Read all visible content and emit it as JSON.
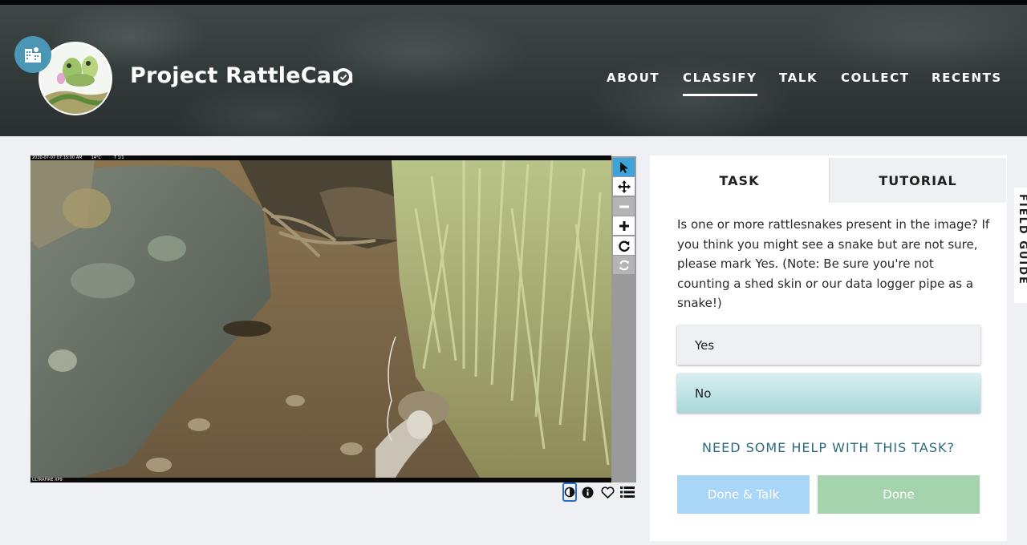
{
  "header": {
    "project_title": "Project RattleCam",
    "nav": [
      {
        "label": "ABOUT",
        "active": false
      },
      {
        "label": "CLASSIFY",
        "active": true
      },
      {
        "label": "TALK",
        "active": false
      },
      {
        "label": "COLLECT",
        "active": false
      },
      {
        "label": "RECENTS",
        "active": false
      }
    ],
    "icons": {
      "org": "organization-building-icon",
      "verified": "verified-check-icon"
    }
  },
  "subject": {
    "camera_stamp": "2020-07-07 07:15:00 AM",
    "temperature": "14°C",
    "trigger": "T 1/1",
    "camera_model": "ULTRAFIRE XP9"
  },
  "toolbar": {
    "tools": [
      {
        "name": "pointer-icon",
        "state": "selected"
      },
      {
        "name": "move-icon",
        "state": "normal"
      },
      {
        "name": "zoom-out-icon",
        "state": "disabled"
      },
      {
        "name": "zoom-in-icon",
        "state": "normal"
      },
      {
        "name": "rotate-icon",
        "state": "normal"
      },
      {
        "name": "reset-icon",
        "state": "disabled"
      }
    ]
  },
  "meta_icons": [
    "invert-icon",
    "info-icon",
    "favorite-heart-icon",
    "collections-list-icon"
  ],
  "task_panel": {
    "tabs": {
      "task": "TASK",
      "tutorial": "TUTORIAL"
    },
    "question": "Is one or more rattlesnakes present in the image? If you think you might see a snake but are not sure, please mark Yes. (Note: Be sure you're not counting a shed skin or our data logger pipe as a snake!)",
    "answers": {
      "yes": "Yes",
      "no": "No"
    },
    "selected_answer": "No",
    "help_link": "NEED SOME HELP WITH THIS TASK?",
    "done_talk": "Done & Talk",
    "done": "Done"
  },
  "field_guide": "FIELD GUIDE",
  "colors": {
    "selected_answer": "#a9d8db",
    "done_talk_button": "#a9d6f7",
    "done_button": "#a5d3ae",
    "help_link": "#2b6b7a",
    "tool_selected": "#3ea3d8",
    "org_badge": "#4b96b4"
  }
}
